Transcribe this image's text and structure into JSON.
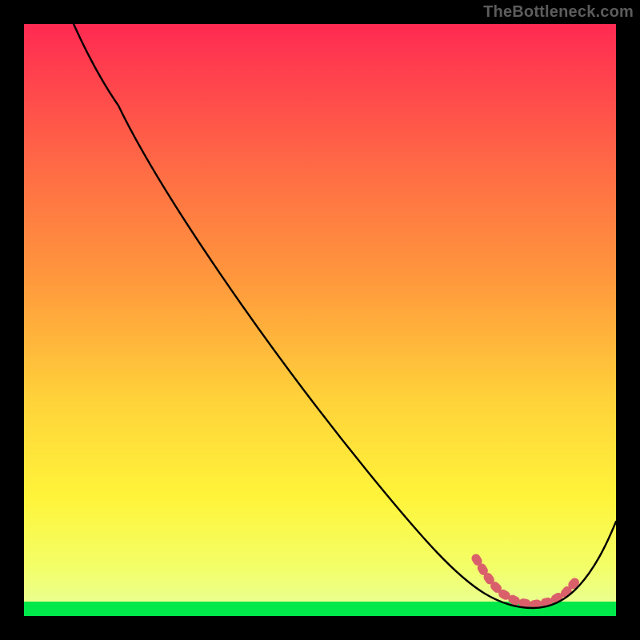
{
  "watermark": "TheBottleneck.com",
  "chart_data": {
    "type": "line",
    "title": "",
    "xlabel": "",
    "ylabel": "",
    "xlim": [
      0,
      100
    ],
    "ylim": [
      0,
      100
    ],
    "grid": false,
    "legend": false,
    "series": [
      {
        "name": "bottleneck-curve",
        "color": "#000000",
        "x": [
          10,
          15,
          20,
          25,
          30,
          35,
          40,
          45,
          50,
          55,
          60,
          65,
          70,
          72,
          75,
          78,
          80,
          82,
          85,
          88,
          90,
          92,
          94,
          96,
          98,
          100
        ],
        "values": [
          100,
          96,
          91,
          85,
          79,
          72,
          66,
          59,
          53,
          46,
          40,
          33,
          26,
          22,
          16,
          10,
          6,
          4,
          2,
          1,
          1,
          2,
          5,
          9,
          14,
          20
        ]
      },
      {
        "name": "optimal-range-marker",
        "color": "#d9606a",
        "x": [
          78,
          80,
          82,
          84,
          86,
          88,
          90,
          92,
          94
        ],
        "values": [
          10,
          6,
          4,
          3,
          2,
          1,
          1,
          2,
          5
        ]
      }
    ],
    "background_gradient": {
      "top": "#ff2a52",
      "mid_upper": "#ff8a3d",
      "mid_lower": "#ffe63a",
      "near_bottom": "#f7ff66",
      "bottom_strip": "#00e84a"
    }
  }
}
